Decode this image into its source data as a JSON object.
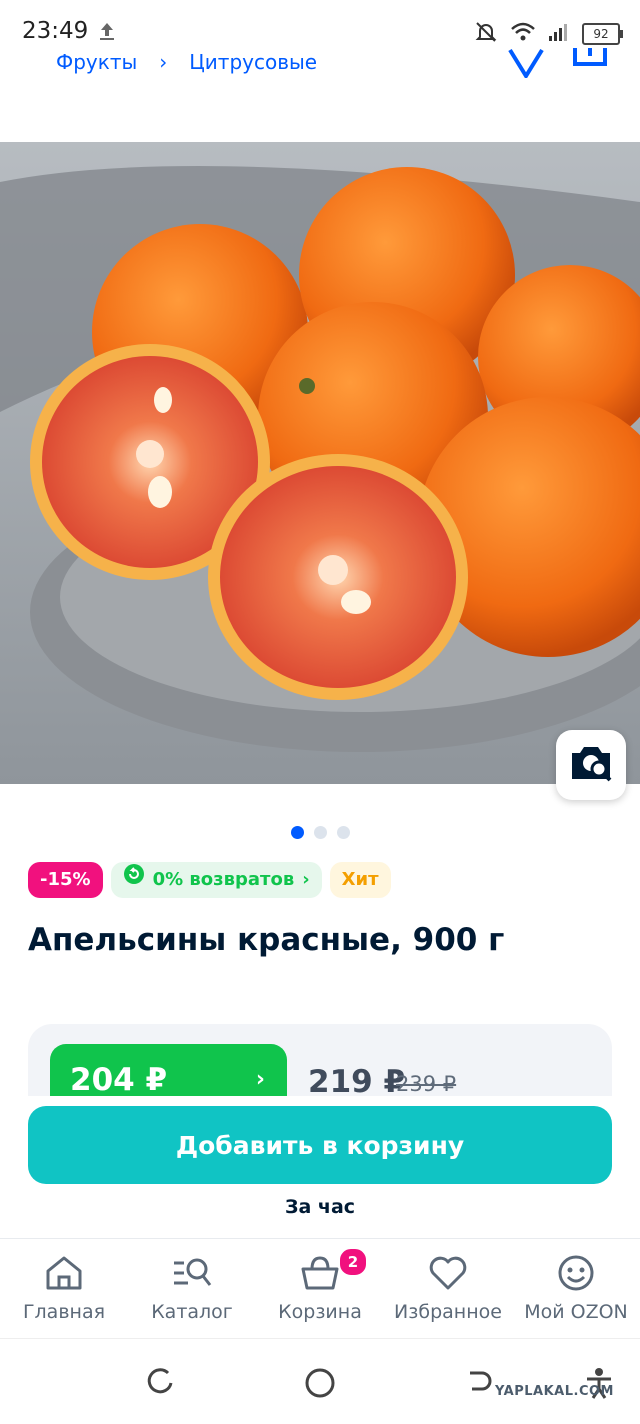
{
  "status_bar": {
    "time": "23:49",
    "battery": "92"
  },
  "breadcrumb": {
    "items": [
      "Фрукты",
      "Цитрусовые"
    ]
  },
  "gallery": {
    "dots": 3,
    "active_index": 0
  },
  "badges": {
    "discount": "-15%",
    "returns": "0% возвратов",
    "hit": "Хит"
  },
  "product": {
    "title": "Апельсины красные, 900 г"
  },
  "price": {
    "ozon_card": "204 ₽",
    "regular": "219 ₽",
    "old": "239 ₽"
  },
  "cart_button": {
    "label": "Добавить в корзину"
  },
  "delivery": {
    "text": "За час"
  },
  "tabbar": {
    "items": [
      {
        "label": "Главная",
        "icon": "home-icon"
      },
      {
        "label": "Каталог",
        "icon": "catalog-search-icon"
      },
      {
        "label": "Корзина",
        "icon": "basket-icon",
        "badge": "2"
      },
      {
        "label": "Избранное",
        "icon": "heart-icon"
      },
      {
        "label": "Мой OZON",
        "icon": "smiley-icon"
      }
    ]
  },
  "watermark": "YAPLAKAL.COM",
  "colors": {
    "accent": "#005bff",
    "green": "#10c44c",
    "teal": "#10c4c4",
    "pink": "#f1117e",
    "orange": "#f49f00"
  }
}
